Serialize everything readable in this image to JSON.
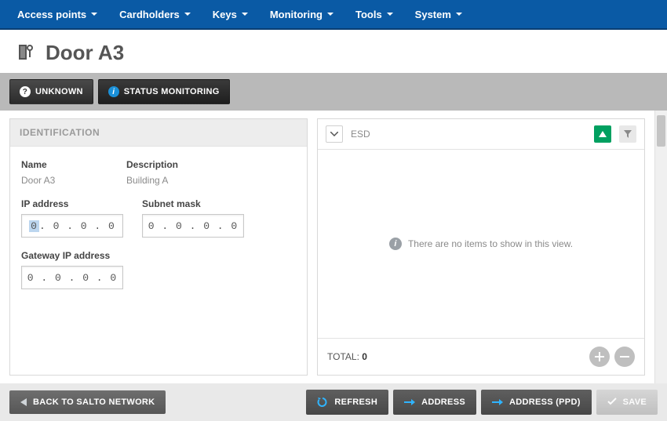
{
  "nav": {
    "items": [
      "Access points",
      "Cardholders",
      "Keys",
      "Monitoring",
      "Tools",
      "System"
    ]
  },
  "page": {
    "title": "Door A3"
  },
  "mode_tabs": {
    "unknown": "UNKNOWN",
    "status": "STATUS MONITORING"
  },
  "identification": {
    "heading": "IDENTIFICATION",
    "name_label": "Name",
    "name_value": "Door A3",
    "description_label": "Description",
    "description_value": "Building A",
    "ip_label": "IP address",
    "ip_value": "0 . 0 . 0 . 0",
    "ip_first_octet": "0",
    "ip_rest": " . 0 . 0 . 0",
    "subnet_label": "Subnet mask",
    "subnet_value": "0 . 0 . 0 . 0",
    "gateway_label": "Gateway IP address",
    "gateway_value": "0 . 0 . 0 . 0"
  },
  "esd": {
    "label": "ESD",
    "empty_text": "There are no items to show in this view.",
    "total_label": "TOTAL:",
    "total_value": "0"
  },
  "footer": {
    "back": "BACK TO SALTO NETWORK",
    "refresh": "REFRESH",
    "address": "ADDRESS",
    "address_ppd": "ADDRESS (PPD)",
    "save": "SAVE"
  }
}
